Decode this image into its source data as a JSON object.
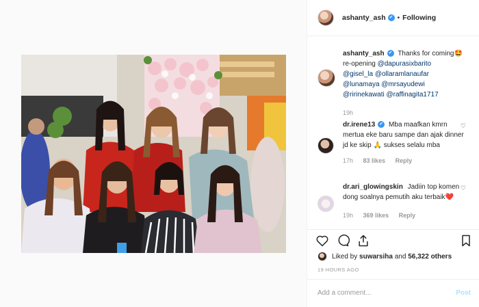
{
  "header": {
    "username": "ashanty_ash",
    "verified_mark": "✔",
    "separator": "•",
    "follow_status": "Following"
  },
  "caption": {
    "username": "ashanty_ash",
    "text_start": "Thanks for coming",
    "emoji_1": "🤩",
    "text_mid": "re-opening",
    "mentions": [
      "@dapurasixbarito",
      "@gisel_la",
      "@ollaramlanaufar",
      "@lunamaya",
      "@mrsayudewi",
      "@ririnekawati",
      "@raffinagita1717"
    ],
    "time": "19h"
  },
  "comments": [
    {
      "username": "dr.irene13",
      "verified": true,
      "text": "Mba maafkan kmrn mertua eke baru sampe dan ajak dinner jd ke skip",
      "emoji": "🙏",
      "text_end": "sukses selalu mba",
      "time": "17h",
      "likes": "83 likes",
      "reply": "Reply"
    },
    {
      "username": "dr.ari_glowingskin",
      "verified": false,
      "text": "Jadiin top komen dong soalnya pemutih aku terbaik",
      "emoji": "❤️",
      "time": "19h",
      "likes": "369 likes",
      "reply": "Reply"
    }
  ],
  "likes": {
    "prefix": "Liked by",
    "user": "suwarsiha",
    "conj": "and",
    "count": "56,322 others"
  },
  "timestamp": "19 HOURS AGO",
  "add_comment": {
    "placeholder": "Add a comment...",
    "post_label": "Post"
  },
  "icons": {
    "like": "heart-icon",
    "comment": "comment-icon",
    "share": "share-icon",
    "save": "bookmark-icon",
    "comment_like": "heart-small-icon"
  },
  "colors": {
    "verified": "#3897f0",
    "mention": "#003569",
    "muted": "#999999",
    "post_disabled": "#b2dffc"
  }
}
